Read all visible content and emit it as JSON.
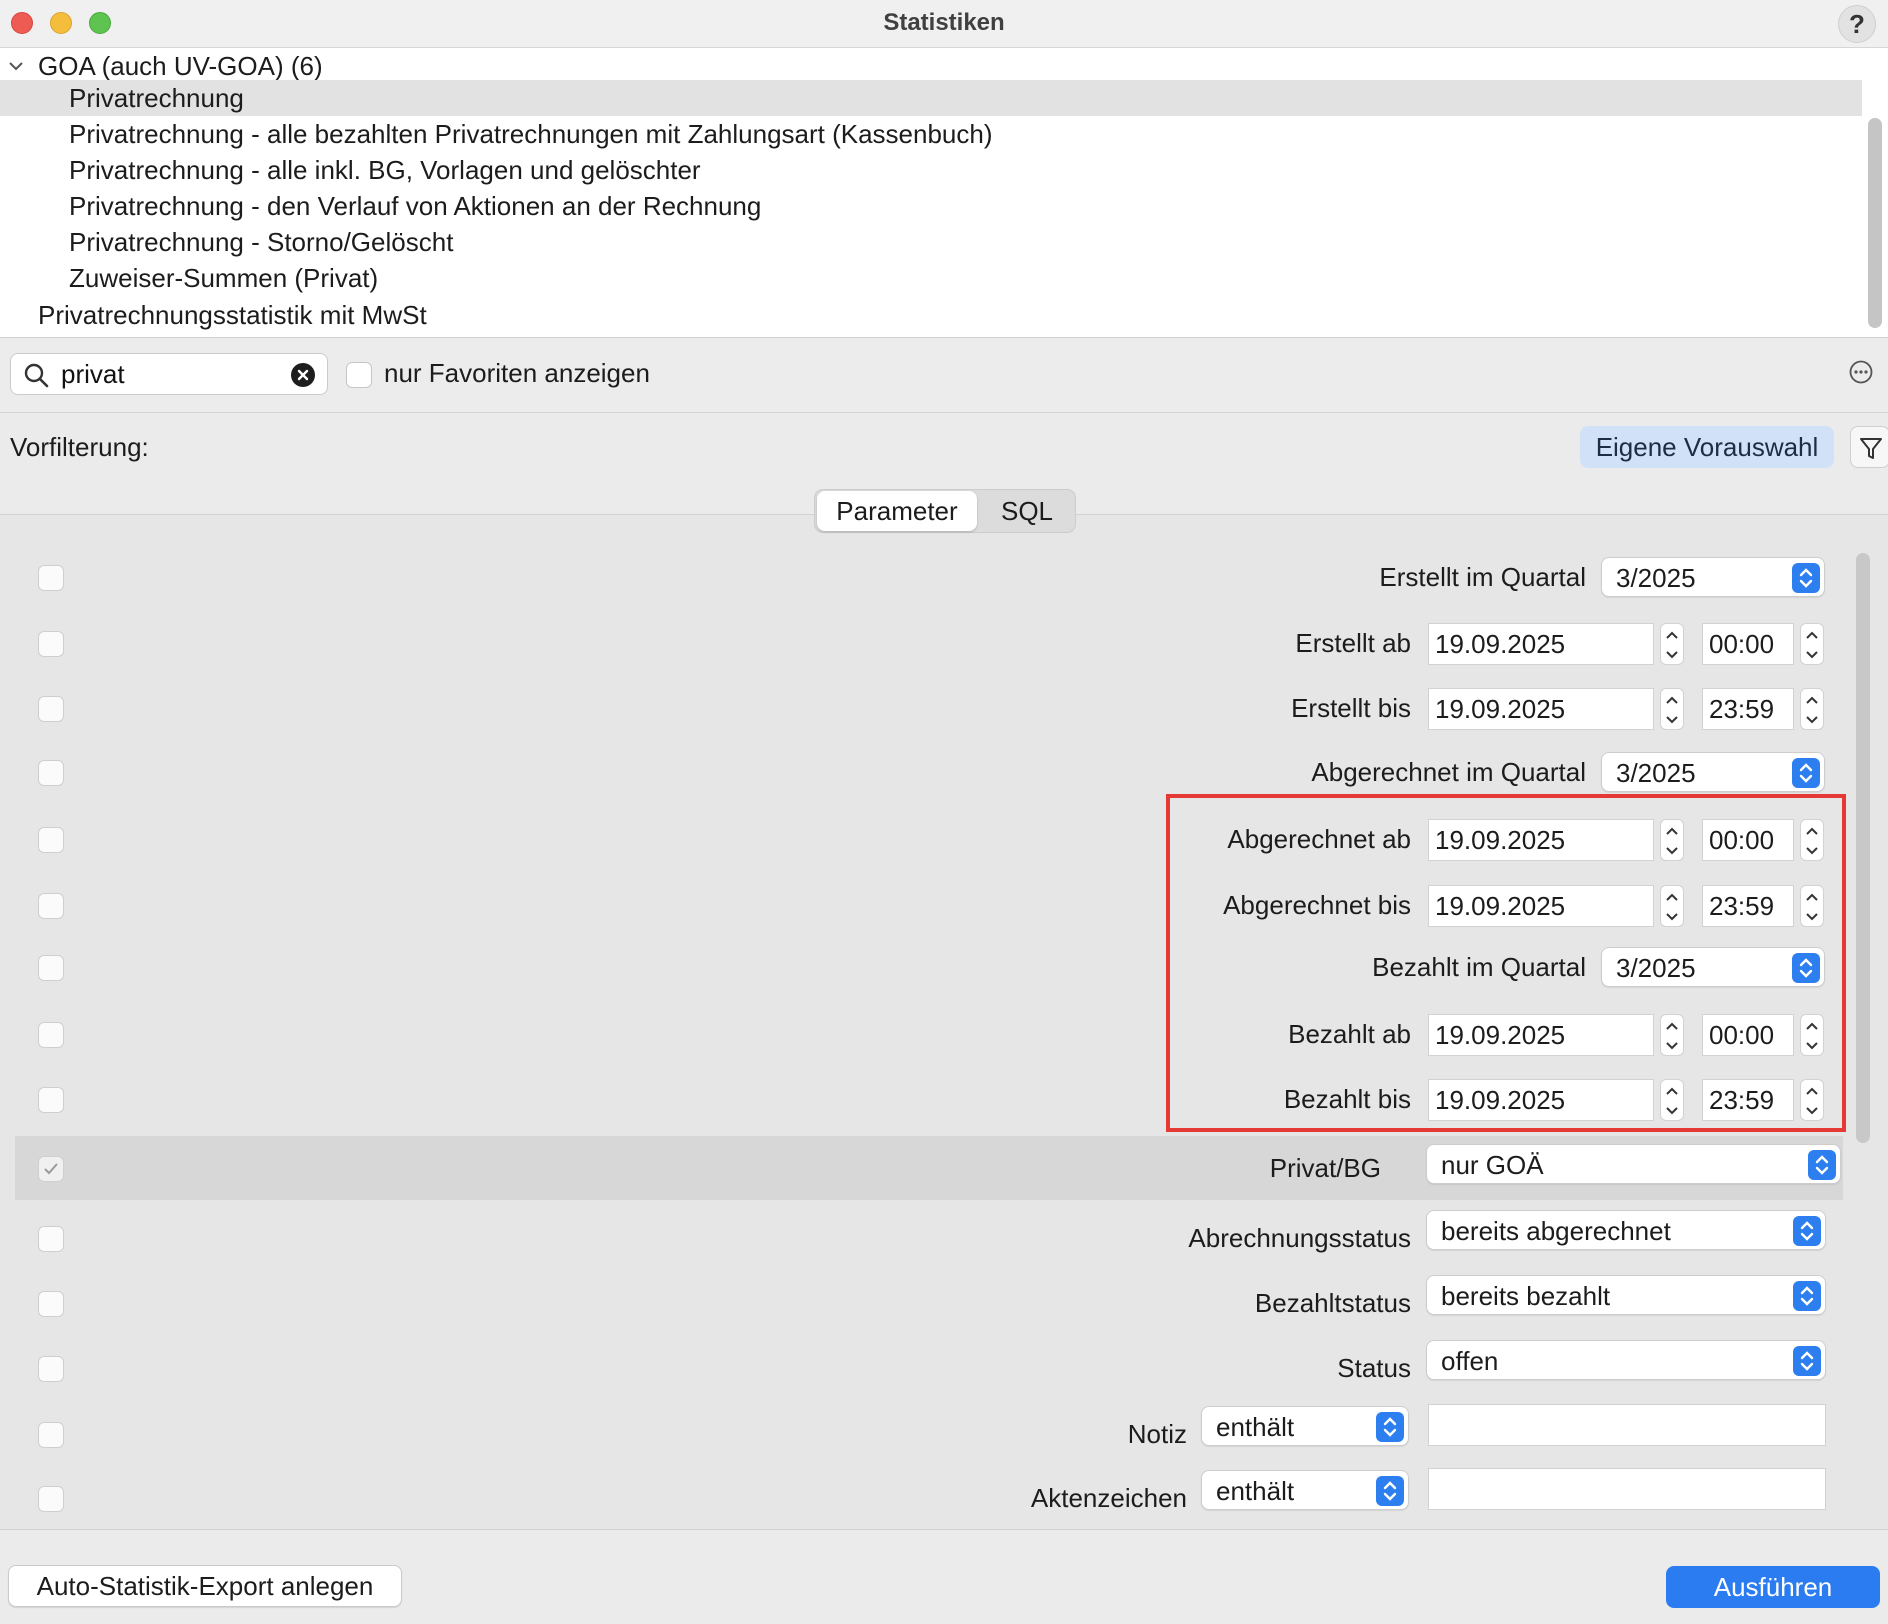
{
  "window": {
    "title": "Statistiken",
    "help_label": "?"
  },
  "tree": {
    "group_label": "GOA (auch UV-GOA) (6)",
    "items": [
      {
        "label": "Privatrechnung",
        "selected": true
      },
      {
        "label": "Privatrechnung - alle bezahlten Privatrechnungen mit Zahlungsart (Kassenbuch)"
      },
      {
        "label": "Privatrechnung - alle inkl. BG, Vorlagen und gelöschter"
      },
      {
        "label": "Privatrechnung - den Verlauf von Aktionen an der Rechnung"
      },
      {
        "label": "Privatrechnung - Storno/Gelöscht"
      },
      {
        "label": "Zuweiser-Summen (Privat)"
      }
    ],
    "root_item": "Privatrechnungsstatistik mit MwSt"
  },
  "search": {
    "value": "privat",
    "favorites_label": "nur Favoriten anzeigen",
    "favorites_checked": false
  },
  "prefilter": {
    "label": "Vorfilterung:",
    "own_selection_button": "Eigene Vorauswahl"
  },
  "tabs": {
    "parameter": "Parameter",
    "sql": "SQL",
    "active": "Parameter"
  },
  "params": {
    "created_quarter": {
      "label": "Erstellt im Quartal",
      "value": "3/2025"
    },
    "created_from": {
      "label": "Erstellt ab",
      "date": "19.09.2025",
      "time": "00:00"
    },
    "created_to": {
      "label": "Erstellt bis",
      "date": "19.09.2025",
      "time": "23:59"
    },
    "billed_quarter": {
      "label": "Abgerechnet im Quartal",
      "value": "3/2025"
    },
    "billed_from": {
      "label": "Abgerechnet ab",
      "date": "19.09.2025",
      "time": "00:00"
    },
    "billed_to": {
      "label": "Abgerechnet bis",
      "date": "19.09.2025",
      "time": "23:59"
    },
    "paid_quarter": {
      "label": "Bezahlt im Quartal",
      "value": "3/2025"
    },
    "paid_from": {
      "label": "Bezahlt ab",
      "date": "19.09.2025",
      "time": "00:00"
    },
    "paid_to": {
      "label": "Bezahlt bis",
      "date": "19.09.2025",
      "time": "23:59"
    },
    "private_bg": {
      "label": "Privat/BG",
      "value": "nur GOÄ",
      "checked": true
    },
    "billing_status": {
      "label": "Abrechnungsstatus",
      "value": "bereits abgerechnet"
    },
    "payment_status": {
      "label": "Bezahltstatus",
      "value": "bereits bezahlt"
    },
    "status": {
      "label": "Status",
      "value": "offen"
    },
    "note": {
      "label": "Notiz",
      "operator": "enthält",
      "value": ""
    },
    "file_reference": {
      "label": "Aktenzeichen",
      "operator": "enthält",
      "value": ""
    }
  },
  "footer": {
    "auto_export_button": "Auto-Statistik-Export anlegen",
    "run_button": "Ausführen"
  },
  "colors": {
    "accent": "#2a7cf0",
    "highlight_box": "#e53935",
    "own_selection_bg": "#d1e2f8"
  }
}
